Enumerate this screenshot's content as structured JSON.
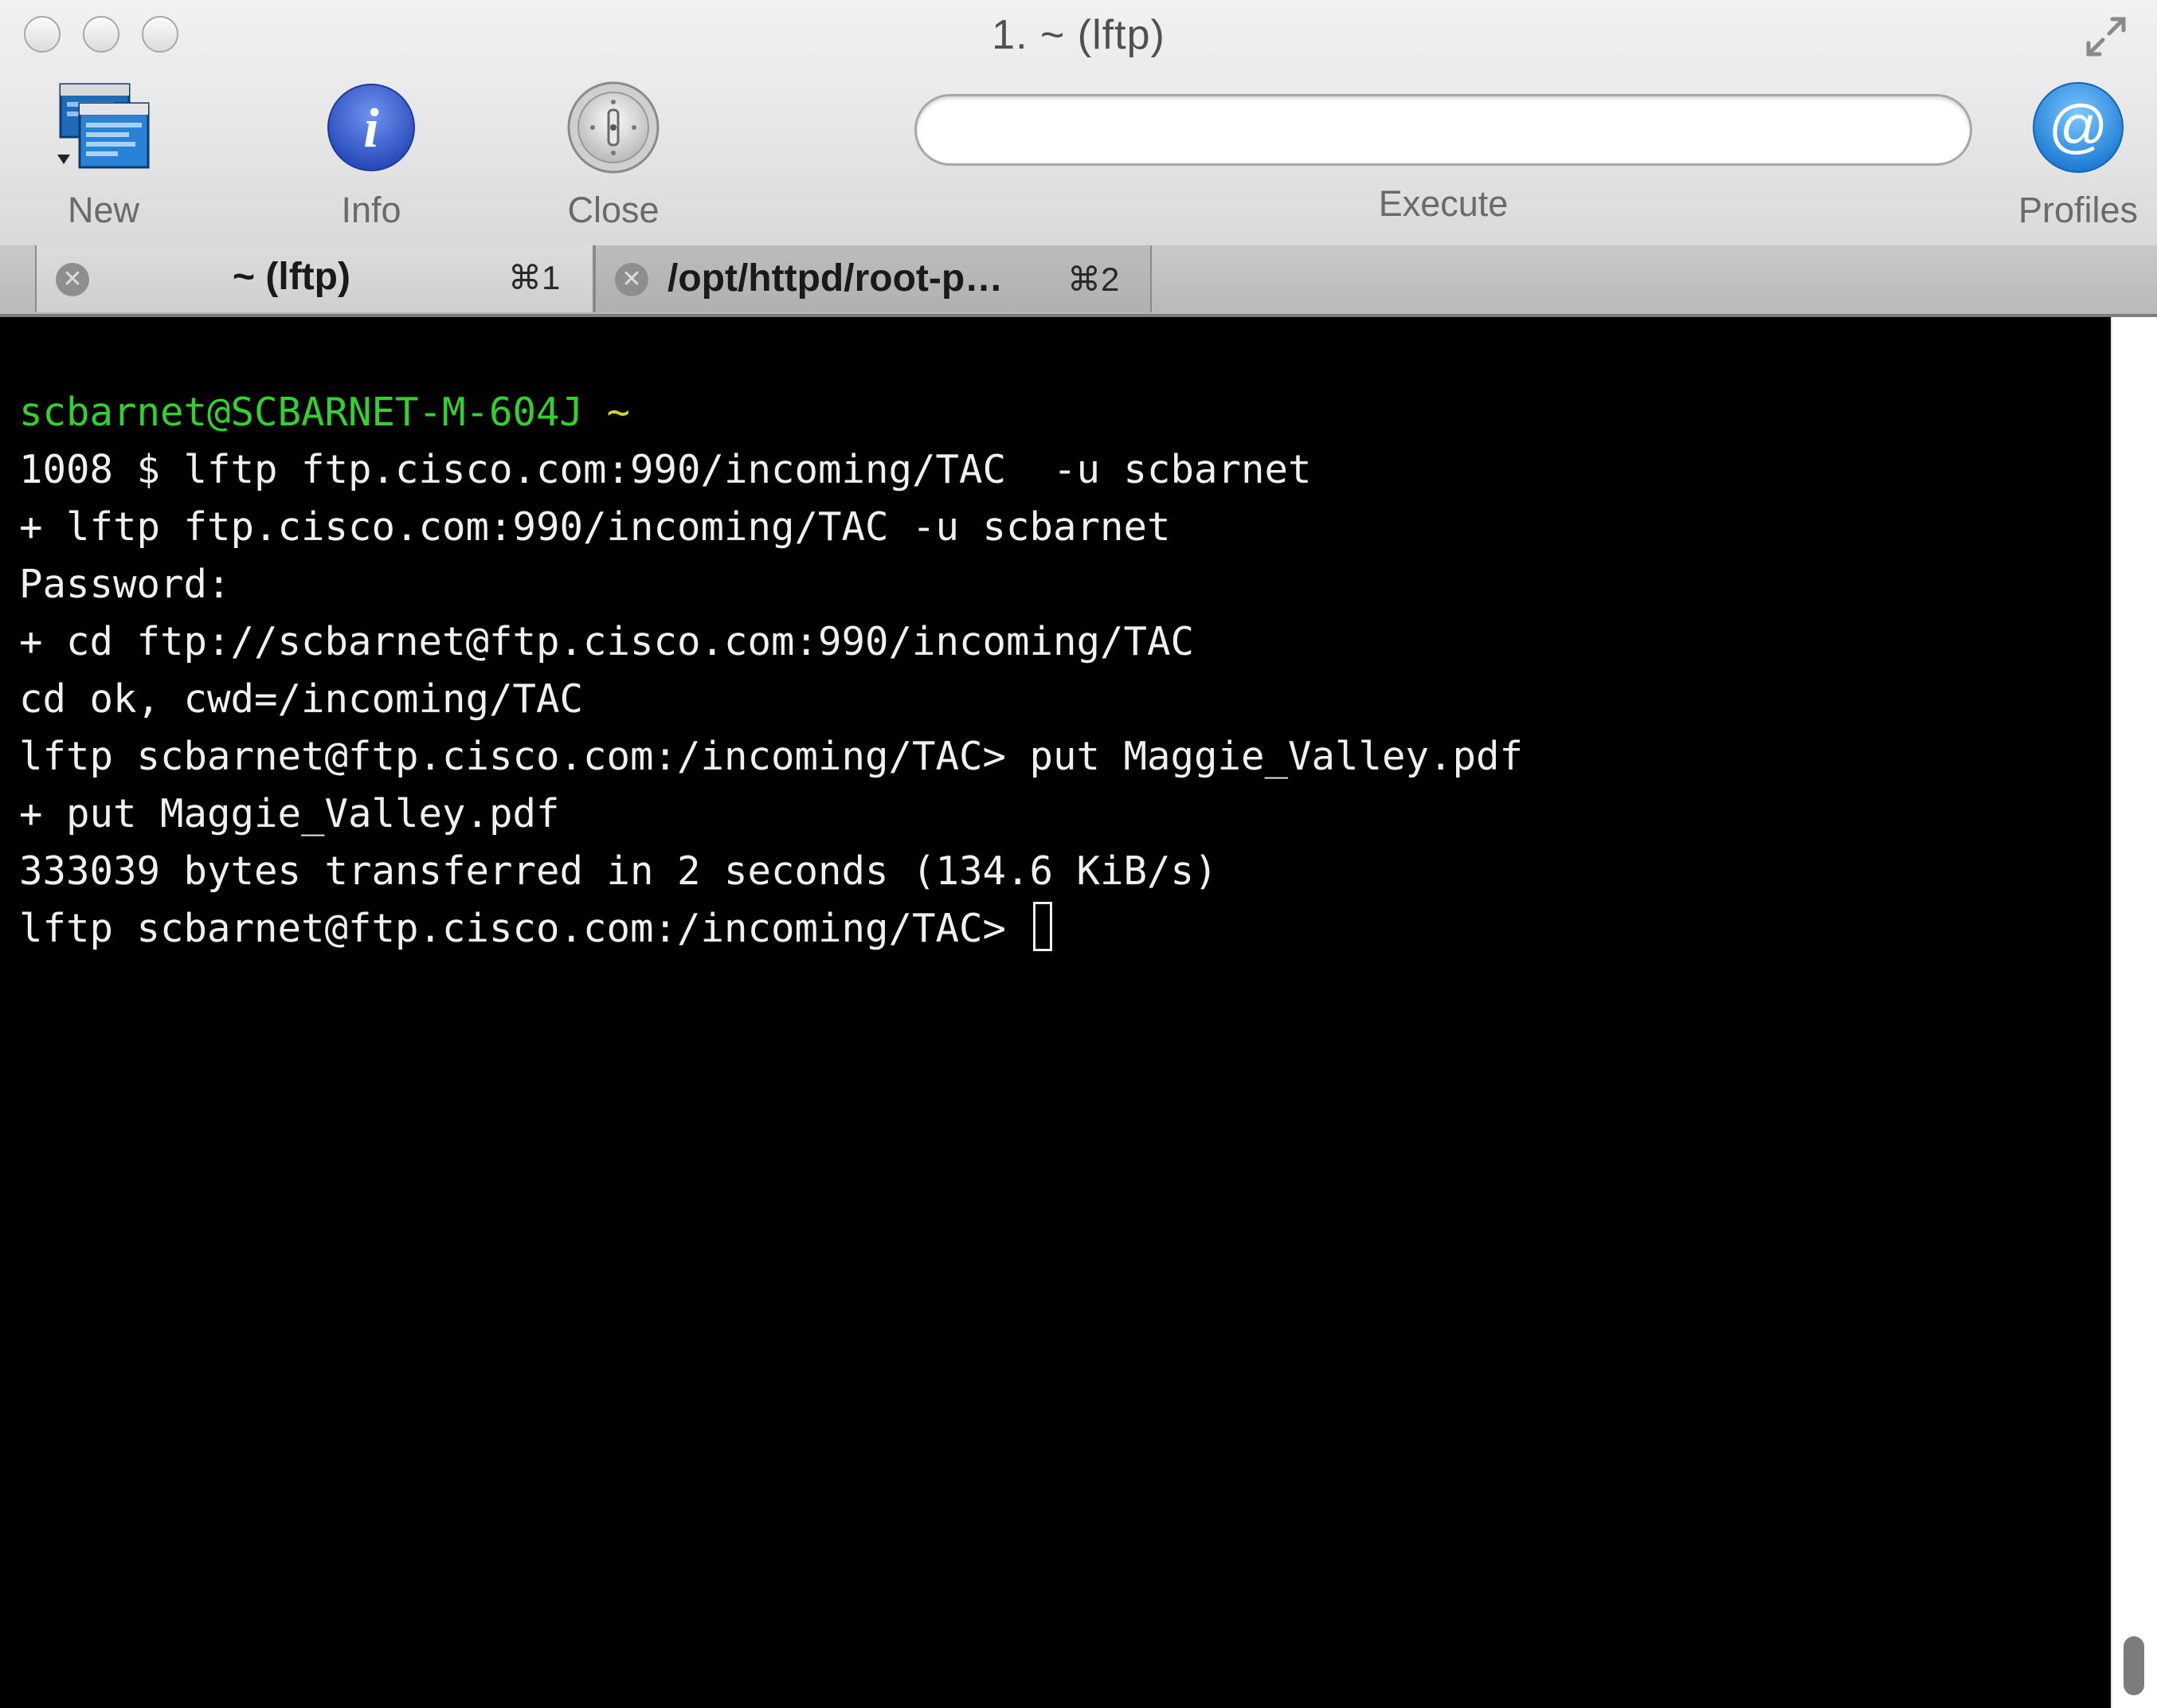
{
  "window": {
    "title": "1. ~ (lftp)"
  },
  "toolbar": {
    "new_label": "New",
    "info_label": "Info",
    "close_label": "Close",
    "execute_label": "Execute",
    "execute_value": "",
    "profiles_label": "Profiles"
  },
  "tabs": [
    {
      "title": "~ (lftp)",
      "shortcut": "⌘1",
      "active": true
    },
    {
      "title": "/opt/httpd/root-p…",
      "shortcut": "⌘2",
      "active": false
    }
  ],
  "terminal": {
    "prompt_user": "scbarnet@SCBARNET-M-604J",
    "prompt_path": "~",
    "lines": [
      "1008 $ lftp ftp.cisco.com:990/incoming/TAC  -u scbarnet",
      "+ lftp ftp.cisco.com:990/incoming/TAC -u scbarnet",
      "Password:",
      "+ cd ftp://scbarnet@ftp.cisco.com:990/incoming/TAC",
      "cd ok, cwd=/incoming/TAC",
      "lftp scbarnet@ftp.cisco.com:/incoming/TAC> put Maggie_Valley.pdf",
      "+ put Maggie_Valley.pdf",
      "333039 bytes transferred in 2 seconds (134.6 KiB/s)"
    ],
    "current_prompt": "lftp scbarnet@ftp.cisco.com:/incoming/TAC> "
  },
  "colors": {
    "terminal_bg": "#000000",
    "terminal_fg": "#f0f0f0",
    "prompt_user": "#33d12f",
    "prompt_tilde": "#d6d12a",
    "profiles_blue": "#2b8de0",
    "info_blue": "#3b63d6"
  },
  "icons": {
    "new": "terminal-windows-icon",
    "info": "info-icon",
    "close": "close-switch-icon",
    "profiles": "at-sign-icon",
    "fullscreen": "fullscreen-arrows-icon",
    "tab_close": "tab-close-icon"
  }
}
